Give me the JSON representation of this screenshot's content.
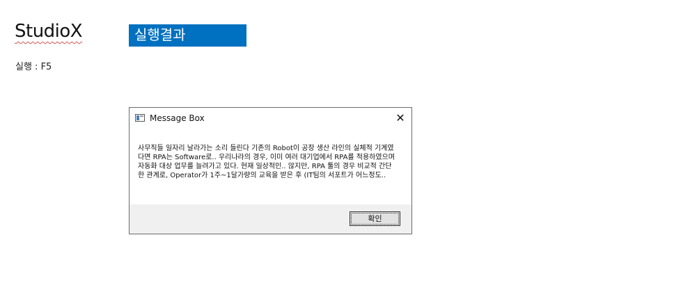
{
  "header": {
    "brand": "StudioX",
    "section_title": "실행결과",
    "run_hint": "실행 : F5"
  },
  "message_box": {
    "title": "Message Box",
    "app_icon": "window-app-icon",
    "close_icon": "close-icon",
    "message": "사무직들 일자리 날라가는 소리 들린다 기존의 Robot이 공장 생산 라인의 실체적 기계였다면 RPA는 Software로.. 우리나라의 경우, 이미 여러 대기업에서 RPA를 적용하였으며 자동화 대상 업무를 늘려가고 있다. 현재 일상적인.. 않지만, RPA 툴의 경우 비교적 간단한 관계로, Operator가 1주~1달가량의 교육을 받은 후 (IT팀의 서포트가 어느정도..",
    "ok_label": "확인"
  },
  "colors": {
    "banner_bg": "#0070c0",
    "footer_bg": "#f0f0f0"
  }
}
